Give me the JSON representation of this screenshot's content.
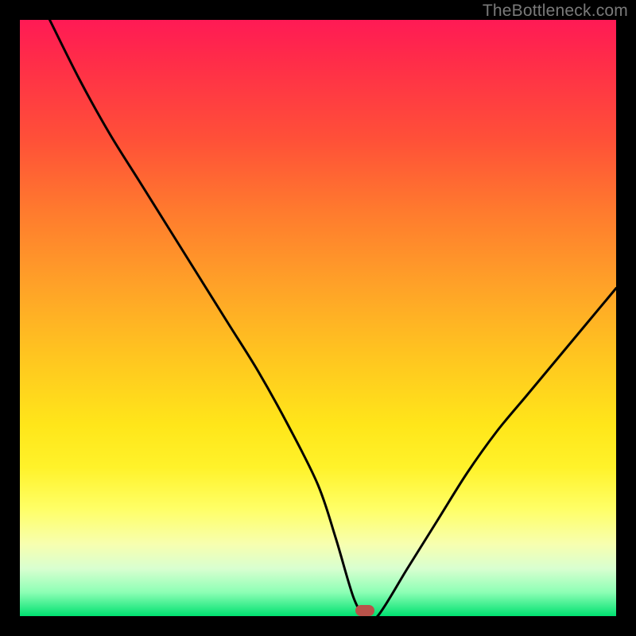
{
  "watermark": {
    "text": "TheBottleneck.com"
  },
  "marker": {
    "x_pct": 57.8,
    "y_pct": 99.0
  },
  "chart_data": {
    "type": "line",
    "title": "",
    "xlabel": "",
    "ylabel": "",
    "xlim": [
      0,
      100
    ],
    "ylim": [
      0,
      100
    ],
    "grid": false,
    "legend": false,
    "series": [
      {
        "name": "bottleneck-curve",
        "x": [
          5,
          10,
          15,
          20,
          25,
          30,
          35,
          40,
          45,
          50,
          53,
          56,
          58,
          60,
          65,
          70,
          75,
          80,
          85,
          90,
          95,
          100
        ],
        "y": [
          100,
          90,
          81,
          73,
          65,
          57,
          49,
          41,
          32,
          22,
          13,
          3,
          0,
          0,
          8,
          16,
          24,
          31,
          37,
          43,
          49,
          55
        ]
      }
    ],
    "annotations": [
      {
        "type": "marker",
        "x": 57.8,
        "y": 0,
        "color": "#b9524a",
        "shape": "pill"
      }
    ],
    "background_gradient": {
      "direction": "top-to-bottom",
      "stops": [
        {
          "pct": 0,
          "color": "#ff1a55"
        },
        {
          "pct": 20,
          "color": "#ff5038"
        },
        {
          "pct": 44,
          "color": "#ffa028"
        },
        {
          "pct": 68,
          "color": "#ffe61a"
        },
        {
          "pct": 88,
          "color": "#f7ffb0"
        },
        {
          "pct": 100,
          "color": "#00e070"
        }
      ]
    }
  }
}
